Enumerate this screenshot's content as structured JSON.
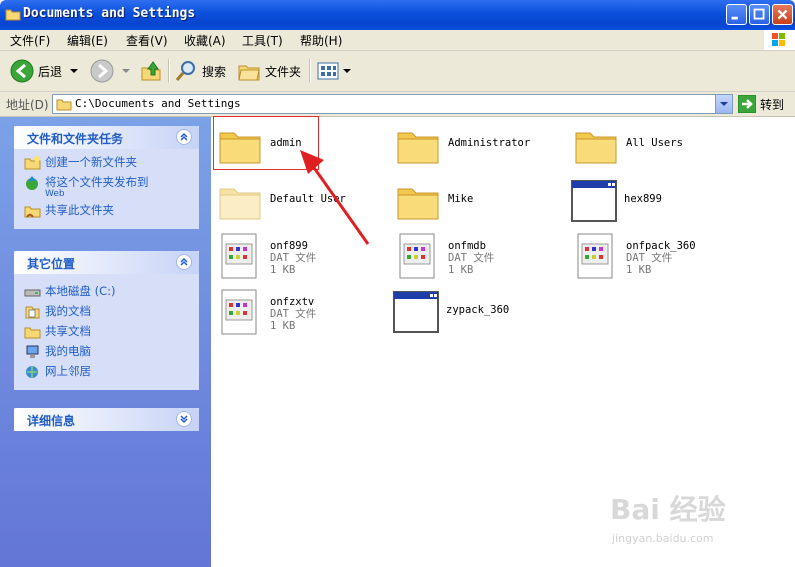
{
  "window": {
    "title": "Documents and Settings"
  },
  "menu": [
    "文件(F)",
    "编辑(E)",
    "查看(V)",
    "收藏(A)",
    "工具(T)",
    "帮助(H)"
  ],
  "toolbar": {
    "back_label": "后退",
    "search_label": "搜索",
    "folders_label": "文件夹"
  },
  "address": {
    "label": "地址(D)",
    "value": "C:\\Documents and Settings",
    "go_label": "转到"
  },
  "tasks_panel": {
    "title": "文件和文件夹任务",
    "items": [
      {
        "label": "创建一个新文件夹",
        "sub": ""
      },
      {
        "label": "将这个文件夹发布到",
        "sub": "Web"
      },
      {
        "label": "共享此文件夹",
        "sub": ""
      }
    ]
  },
  "places_panel": {
    "title": "其它位置",
    "items": [
      "本地磁盘 (C:)",
      "我的文档",
      "共享文档",
      "我的电脑",
      "网上邻居"
    ]
  },
  "details_panel": {
    "title": "详细信息"
  },
  "files": [
    {
      "name": "admin",
      "kind": "folder"
    },
    {
      "name": "Administrator",
      "kind": "folder"
    },
    {
      "name": "All Users",
      "kind": "folder"
    },
    {
      "name": "Default User",
      "kind": "folder-faded"
    },
    {
      "name": "Mike",
      "kind": "folder"
    },
    {
      "name": "hex899",
      "kind": "window"
    },
    {
      "name": "onf899",
      "kind": "dat",
      "type": "DAT 文件",
      "size": "1 KB"
    },
    {
      "name": "onfmdb",
      "kind": "dat",
      "type": "DAT 文件",
      "size": "1 KB"
    },
    {
      "name": "onfpack_360",
      "kind": "dat",
      "type": "DAT 文件",
      "size": "1 KB"
    },
    {
      "name": "onfzxtv",
      "kind": "dat",
      "type": "DAT 文件",
      "size": "1 KB"
    },
    {
      "name": "zypack_360",
      "kind": "window"
    }
  ],
  "watermark": {
    "brand": "Bai 经验",
    "url": "jingyan.baidu.com"
  },
  "colors": {
    "title_bar": "#0a4fdc",
    "panel_link": "#215dc6",
    "highlight": "#e03030"
  }
}
